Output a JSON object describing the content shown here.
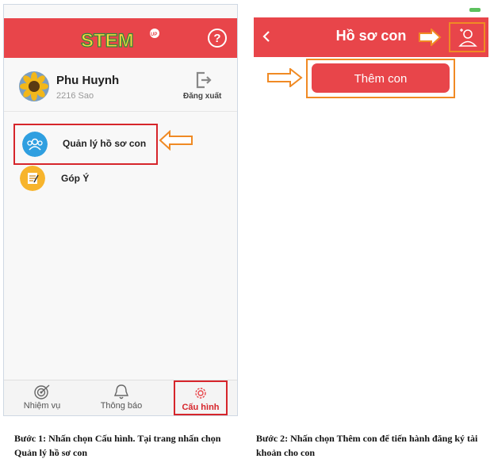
{
  "left_screen": {
    "header": {
      "logo_text": "STEM",
      "logo_badge": "UP",
      "help_icon": "help-circle-icon"
    },
    "profile": {
      "name": "Phu Huynh",
      "score": "2216 Sao",
      "logout_label": "Đăng xuất"
    },
    "menu": [
      {
        "label": "Quản lý hồ sơ con",
        "icon": "people-icon"
      },
      {
        "label": "Góp Ý",
        "icon": "notepad-icon"
      }
    ],
    "tabs": [
      {
        "label": "Nhiệm vụ",
        "icon": "target-icon"
      },
      {
        "label": "Thông báo",
        "icon": "bell-icon"
      },
      {
        "label": "Cấu hình",
        "icon": "gear-icon"
      }
    ]
  },
  "right_screen": {
    "header": {
      "title": "Hồ sơ con"
    },
    "add_button_label": "Thêm con"
  },
  "captions": {
    "step1": "Bước 1: Nhấn chọn Cấu hình. Tại trang nhấn chọn Quản lý hồ sơ con",
    "step2": "Bước 2: Nhấn chọn Thêm con để tiến hành đăng ký tài khoản cho con"
  },
  "colors": {
    "brand_red": "#e8454a",
    "highlight_red": "#d6252b",
    "arrow_orange": "#f08a24"
  }
}
